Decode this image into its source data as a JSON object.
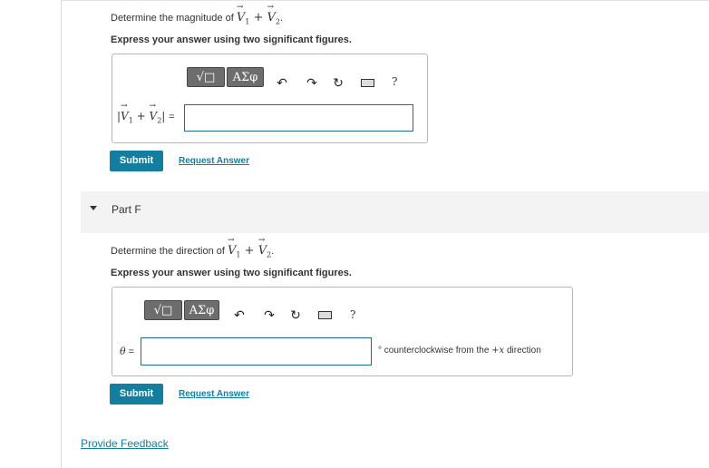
{
  "partE": {
    "question": "Determine the magnitude of V1 + V2.",
    "instruction": "Express your answer using two significant figures.",
    "toolbar": {
      "templates_label": "√□",
      "greek_label": "ΑΣφ",
      "help_label": "?"
    },
    "answer_label": "|V1 + V2| =",
    "answer_value": "",
    "submit_label": "Submit",
    "request_label": "Request Answer"
  },
  "partF": {
    "title": "Part F",
    "question": "Determine the direction of V1 + V2.",
    "instruction": "Express your answer using two significant figures.",
    "toolbar": {
      "templates_label": "√□",
      "greek_label": "ΑΣφ",
      "help_label": "?"
    },
    "answer_label": "θ =",
    "answer_value": "",
    "unit": "° counterclockwise from the +x direction",
    "submit_label": "Submit",
    "request_label": "Request Answer"
  },
  "footer": {
    "feedback_label": "Provide Feedback"
  },
  "icons": [
    "undo-icon",
    "redo-icon",
    "reset-icon",
    "keyboard-icon",
    "help-icon",
    "collapse-triangle-icon"
  ],
  "colors": {
    "accent": "#137e9f",
    "field_border": "#1a6e90",
    "toolbar_button": "#6d6d6d"
  }
}
